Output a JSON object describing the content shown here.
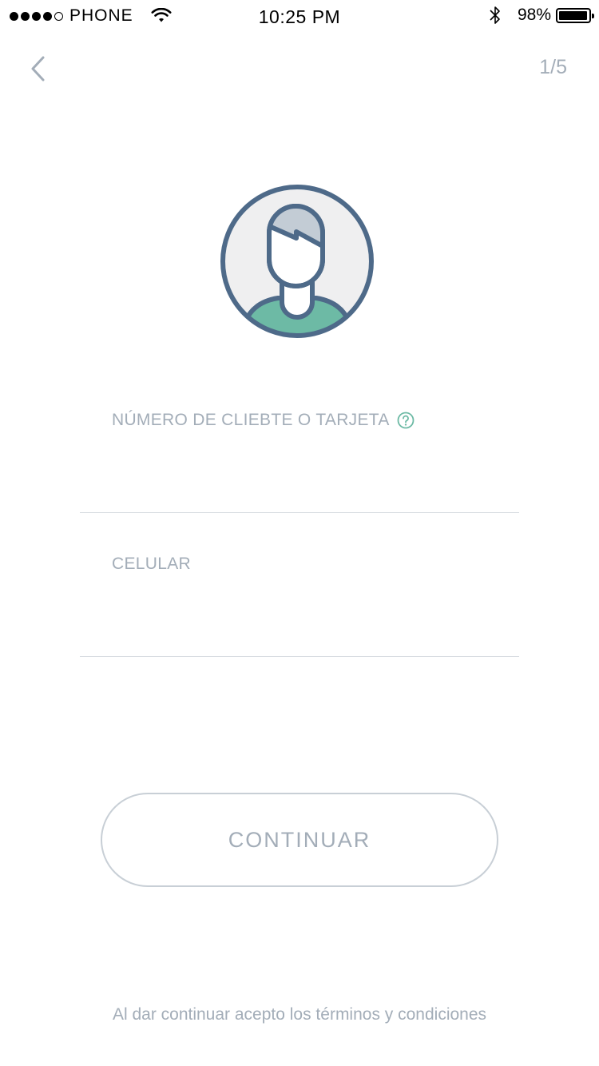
{
  "status_bar": {
    "carrier": "PHONE",
    "time": "10:25 PM",
    "battery_percent": "98%",
    "battery_level": 0.98,
    "signal_bars_filled": 4,
    "signal_bars_total": 5
  },
  "nav": {
    "back_icon": "chevron-left-icon",
    "step": "1/5"
  },
  "avatar": {
    "icon": "user-avatar-icon"
  },
  "form": {
    "client_field": {
      "label": "NÚMERO DE CLIEBTE O TARJETA",
      "value": "",
      "help_icon": "question-circle-icon"
    },
    "phone_field": {
      "label": "CELULAR",
      "value": ""
    }
  },
  "continue_button": {
    "label": "CONTINUAR"
  },
  "footer": {
    "terms": "Al dar continuar acepto los términos y condiciones"
  },
  "colors": {
    "primary_dark": "#4e6a89",
    "accent_green": "#6dbaa5",
    "muted_text": "#a3adb8",
    "divider": "#d7dbe0",
    "button_border": "#c8cfd6"
  }
}
